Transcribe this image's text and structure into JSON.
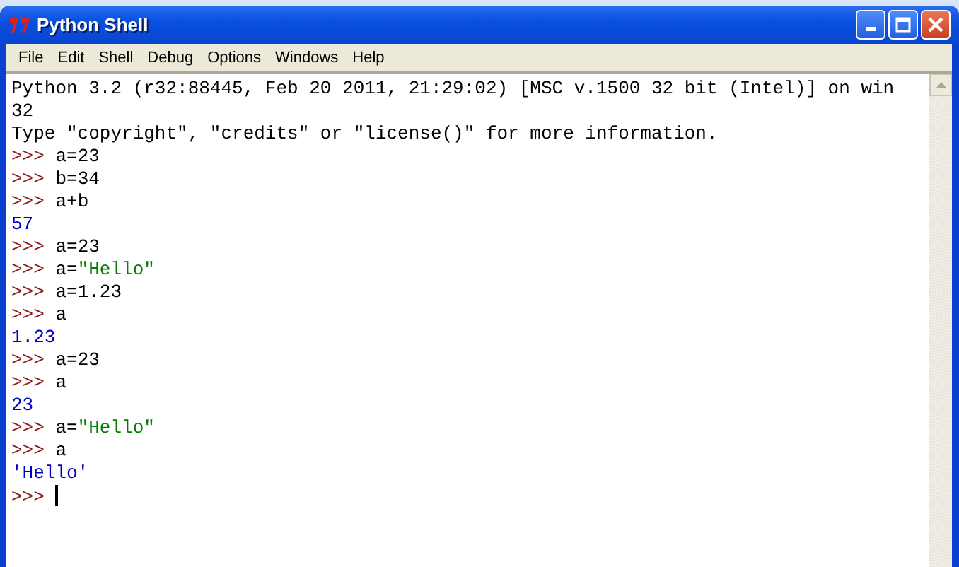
{
  "window": {
    "title": "Python Shell"
  },
  "menu": [
    "File",
    "Edit",
    "Shell",
    "Debug",
    "Options",
    "Windows",
    "Help"
  ],
  "lines": [
    [
      {
        "kind": "output",
        "text": "Python 3.2 (r32:88445, Feb 20 2011, 21:29:02) [MSC v.1500 32 bit (Intel)] on win"
      }
    ],
    [
      {
        "kind": "output",
        "text": "32"
      }
    ],
    [
      {
        "kind": "output",
        "text": "Type \"copyright\", \"credits\" or \"license()\" for more information."
      }
    ],
    [
      {
        "kind": "prompt",
        "text": ">>> "
      },
      {
        "kind": "input",
        "text": "a=23"
      }
    ],
    [
      {
        "kind": "prompt",
        "text": ">>> "
      },
      {
        "kind": "input",
        "text": "b=34"
      }
    ],
    [
      {
        "kind": "prompt",
        "text": ">>> "
      },
      {
        "kind": "input",
        "text": "a+b"
      }
    ],
    [
      {
        "kind": "result",
        "text": "57"
      }
    ],
    [
      {
        "kind": "prompt",
        "text": ">>> "
      },
      {
        "kind": "input",
        "text": "a=23"
      }
    ],
    [
      {
        "kind": "prompt",
        "text": ">>> "
      },
      {
        "kind": "input",
        "text": "a="
      },
      {
        "kind": "string",
        "text": "\"Hello\""
      }
    ],
    [
      {
        "kind": "prompt",
        "text": ">>> "
      },
      {
        "kind": "input",
        "text": "a=1.23"
      }
    ],
    [
      {
        "kind": "prompt",
        "text": ">>> "
      },
      {
        "kind": "input",
        "text": "a"
      }
    ],
    [
      {
        "kind": "result",
        "text": "1.23"
      }
    ],
    [
      {
        "kind": "prompt",
        "text": ">>> "
      },
      {
        "kind": "input",
        "text": "a=23"
      }
    ],
    [
      {
        "kind": "prompt",
        "text": ">>> "
      },
      {
        "kind": "input",
        "text": "a"
      }
    ],
    [
      {
        "kind": "result",
        "text": "23"
      }
    ],
    [
      {
        "kind": "prompt",
        "text": ">>> "
      },
      {
        "kind": "input",
        "text": "a="
      },
      {
        "kind": "string",
        "text": "\"Hello\""
      }
    ],
    [
      {
        "kind": "prompt",
        "text": ">>> "
      },
      {
        "kind": "input",
        "text": "a"
      }
    ],
    [
      {
        "kind": "result",
        "text": "'Hello'"
      }
    ],
    [
      {
        "kind": "prompt",
        "text": ">>> "
      }
    ]
  ]
}
